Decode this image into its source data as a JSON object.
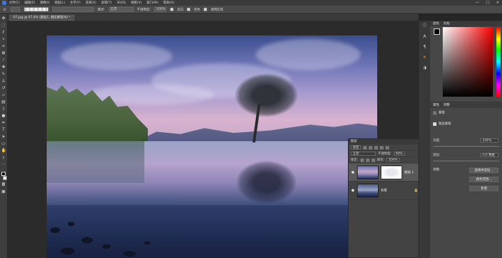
{
  "menubar": {
    "items": [
      "文件(F)",
      "编辑(E)",
      "图像(I)",
      "图层(L)",
      "文字(Y)",
      "选择(S)",
      "滤镜(T)",
      "3D(D)",
      "视图(V)",
      "窗口(W)",
      "帮助(H)"
    ],
    "window_controls": [
      "—",
      "□",
      "✕"
    ]
  },
  "options": {
    "mode_label": "模式:",
    "mode_value": "正常",
    "opacity_label": "不透明度:",
    "opacity_value": "100%",
    "reverse_label": "反向",
    "dither_label": "仿色",
    "transparency_label": "透明区域"
  },
  "document": {
    "tab_label": "07.jpg @ 67.4% (图层1, 图层蒙版/8) *"
  },
  "layers_panel": {
    "title": "图层",
    "close_glyph": "≡",
    "kind_label": "类型",
    "blend_mode": "正常",
    "opacity_label": "不透明度:",
    "opacity_value": "90%",
    "lock_label": "锁定:",
    "fill_label": "填充:",
    "fill_value": "100%",
    "layers": [
      {
        "name": "图层 1",
        "active": true
      },
      {
        "name": "背景",
        "active": false
      }
    ],
    "lock_glyph": "🔒"
  },
  "right_panel": {
    "color_tabs": [
      "颜色",
      "色板"
    ],
    "props_tabs": [
      "属性",
      "调整"
    ],
    "mask_label": "蒙版",
    "layer_mask_label": "图层蒙版",
    "density_label": "浓度:",
    "density_value": "100%",
    "feather_label": "羽化:",
    "feather_value": "0.0 像素",
    "adjust_label": "调整:",
    "buttons": [
      "选择并遮住...",
      "颜色范围...",
      "反相"
    ]
  },
  "colors": {
    "accent": "#f0a030",
    "selection": "#595959"
  }
}
